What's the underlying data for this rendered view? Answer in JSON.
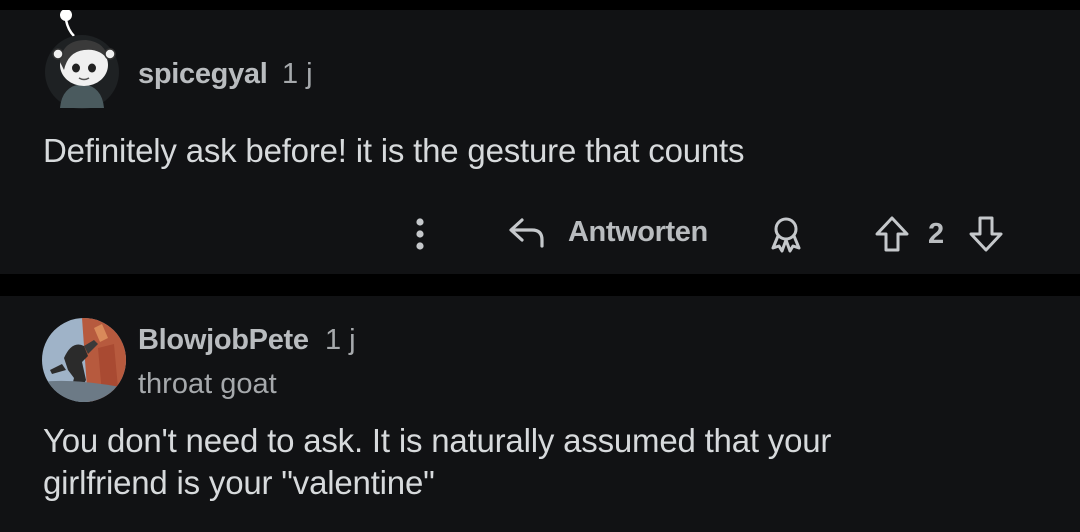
{
  "comments": [
    {
      "username": "spicegyal",
      "age": "1 j",
      "body": "Definitely ask before! it is the gesture that counts",
      "actions": {
        "more_icon": "more-vertical-icon",
        "reply_icon": "reply-arrow-icon",
        "reply_label": "Antworten",
        "award_icon": "award-icon",
        "upvote_icon": "upvote-arrow-icon",
        "score": "2",
        "downvote_icon": "downvote-arrow-icon"
      }
    },
    {
      "username": "BlowjobPete",
      "age": "1 j",
      "flair": "throat goat",
      "body": "You don't need to ask. It is naturally assumed that your girlfriend is your \"valentine\""
    }
  ],
  "colors": {
    "page_background": "#000000",
    "card_background": "#111214",
    "text_primary": "#d7dadc",
    "text_secondary": "#b9bcbf"
  }
}
